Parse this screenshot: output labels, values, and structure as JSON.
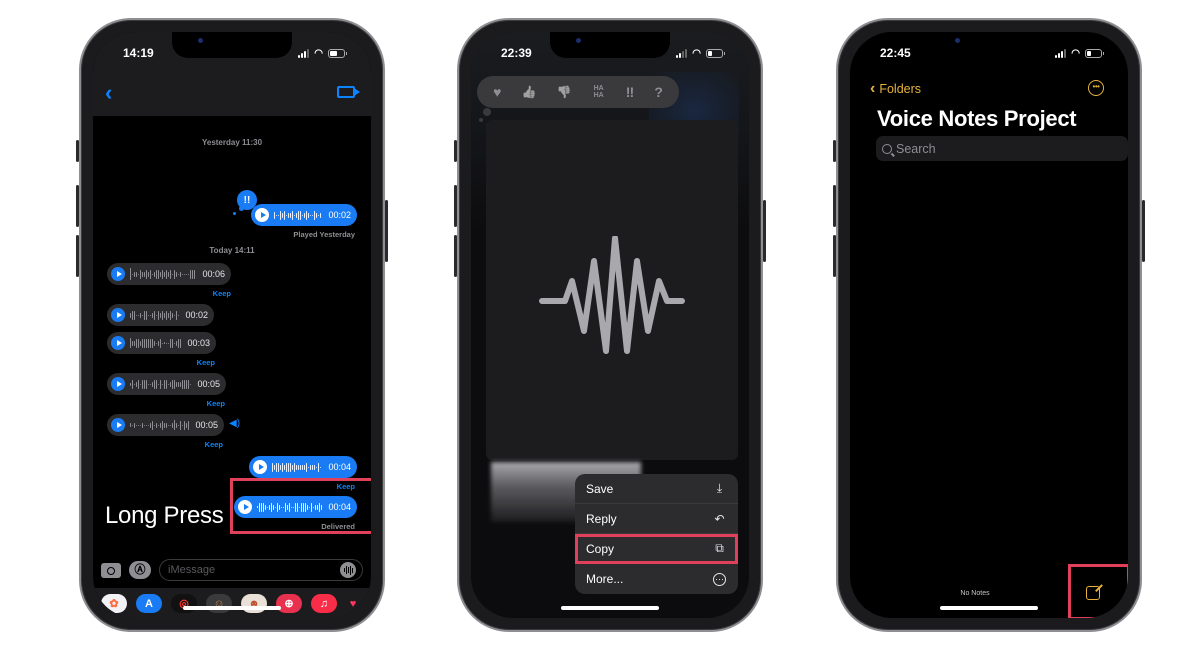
{
  "colors": {
    "imessage_blue": "#1a7cf5",
    "link_blue": "#0a84ff",
    "notes_yellow": "#e6b33c",
    "highlight_red": "#e0405a"
  },
  "phone1": {
    "status": {
      "time": "14:19"
    },
    "header": {
      "back_icon": "chevron-left-icon",
      "video_icon": "video-camera-icon"
    },
    "timestamps": [
      "Yesterday 11:30",
      "Today 14:11"
    ],
    "tapback": {
      "label": "!!"
    },
    "messages": [
      {
        "direction": "out",
        "duration": "00:02",
        "meta": "Played Yesterday",
        "meta_type": "gray"
      },
      {
        "direction": "in",
        "duration": "00:06",
        "meta": "Keep",
        "meta_type": "keep"
      },
      {
        "direction": "in",
        "duration": "00:02",
        "meta": "",
        "meta_type": ""
      },
      {
        "direction": "in",
        "duration": "00:03",
        "meta": "Keep",
        "meta_type": "keep"
      },
      {
        "direction": "in",
        "duration": "00:05",
        "meta": "Keep",
        "meta_type": "keep"
      },
      {
        "direction": "in",
        "duration": "00:05",
        "meta": "Keep",
        "meta_type": "keep",
        "speaker": true
      },
      {
        "direction": "out",
        "duration": "00:04",
        "meta": "Keep",
        "meta_type": "keep"
      },
      {
        "direction": "out",
        "duration": "00:04",
        "meta": "Delivered",
        "meta_type": "gray"
      }
    ],
    "annotation": "Long Press",
    "input": {
      "placeholder": "iMessage"
    },
    "app_drawer": [
      "Photos",
      "App Store",
      "Activity",
      "Memoji Stickers",
      "Memoji",
      "Images Search",
      "Music",
      "Digital Touch"
    ]
  },
  "phone2": {
    "status": {
      "time": "22:39"
    },
    "reactions": [
      {
        "name": "heart",
        "glyph": "♥"
      },
      {
        "name": "thumbs-up",
        "glyph": "👍"
      },
      {
        "name": "thumbs-down",
        "glyph": "👎"
      },
      {
        "name": "haha",
        "glyph": "HA HA"
      },
      {
        "name": "exclamation",
        "glyph": "‼"
      },
      {
        "name": "question",
        "glyph": "?"
      }
    ],
    "menu": [
      {
        "label": "Save",
        "icon": "save-icon",
        "glyph": "⤓"
      },
      {
        "label": "Reply",
        "icon": "reply-icon",
        "glyph": "↶"
      },
      {
        "label": "Copy",
        "icon": "copy-icon",
        "glyph": "⧉",
        "highlighted": true
      },
      {
        "label": "More...",
        "icon": "more-circle-icon",
        "glyph": "⋯"
      }
    ]
  },
  "phone3": {
    "status": {
      "time": "22:45"
    },
    "back_label": "Folders",
    "title": "Voice Notes Project",
    "search_placeholder": "Search",
    "empty_label": "No Notes",
    "more_glyph": "•••"
  }
}
